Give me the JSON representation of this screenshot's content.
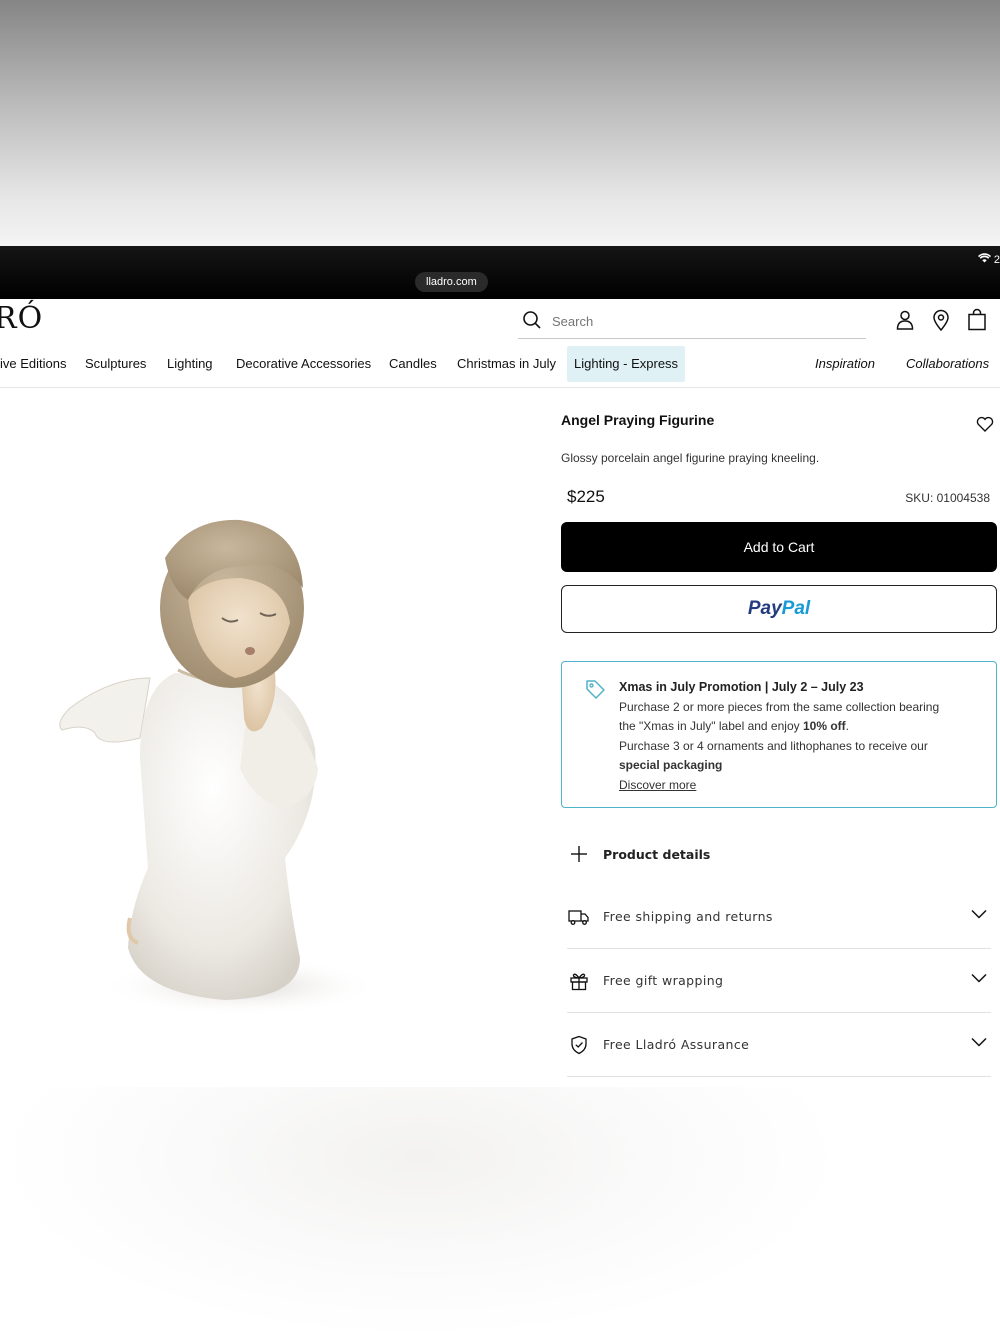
{
  "browser": {
    "url": "lladro.com",
    "status_text": "2"
  },
  "header": {
    "logo_text": "RÓ",
    "search_placeholder": "Search",
    "icons": [
      "account-icon",
      "store-locator-icon",
      "cart-icon"
    ]
  },
  "nav": {
    "items": [
      "ive Editions",
      "Sculptures",
      "Lighting",
      "Decorative Accessories",
      "Candles",
      "Christmas in July",
      "Lighting - Express"
    ],
    "secondary": [
      "Inspiration",
      "Collaborations"
    ]
  },
  "product": {
    "title": "Angel Praying Figurine",
    "description": "Glossy porcelain angel figurine praying kneeling.",
    "price": "$225",
    "sku": "SKU: 01004538",
    "add_to_cart": "Add to Cart",
    "paypal_pay": "Pay",
    "paypal_pal": "Pal"
  },
  "promo": {
    "title": "Xmas in July Promotion | July 2 – July 23",
    "line1": "Purchase 2 or more pieces from the same collection bearing",
    "line2_a": "the \"Xmas in July\" label and enjoy ",
    "line2_b": "10% off",
    "line2_c": ".",
    "line3": "Purchase 3 or 4 ornaments and lithophanes to receive our",
    "line4": "special packaging",
    "link": "Discover more"
  },
  "accordion": {
    "details": "Product details",
    "shipping": "Free shipping and returns",
    "gift": "Free gift wrapping",
    "assurance": "Free Lladró Assurance"
  },
  "colors": {
    "accent_highlight": "#dff1f5",
    "promo_border": "#4fb3c9",
    "paypal_dark": "#253b80",
    "paypal_light": "#179bd7"
  }
}
